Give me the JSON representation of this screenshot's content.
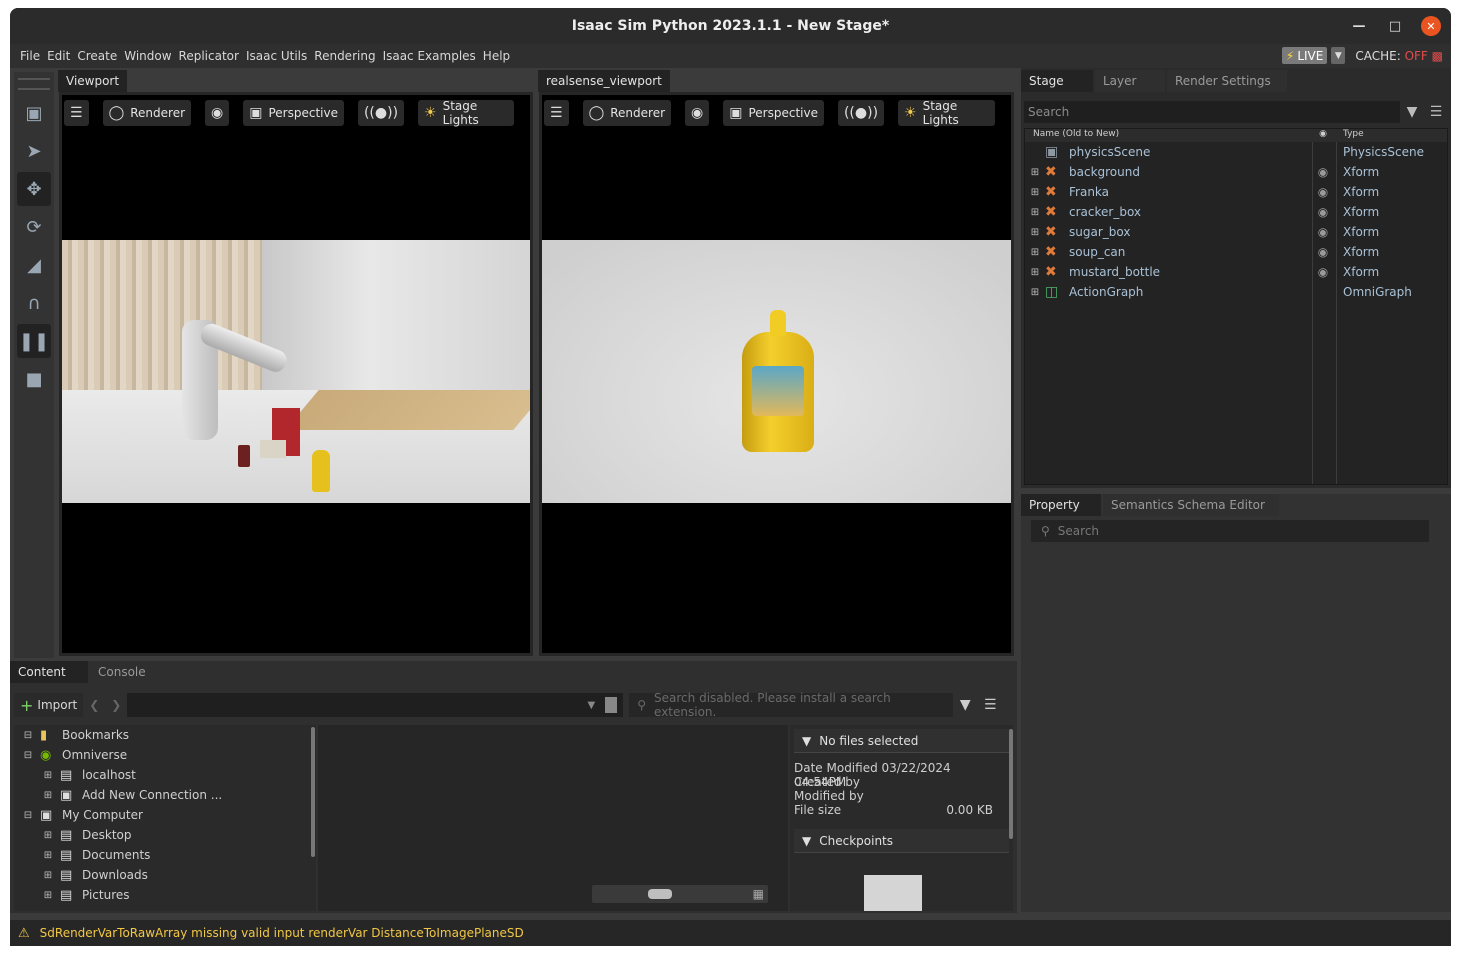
{
  "window": {
    "title": "Isaac Sim Python 2023.1.1 - New Stage*"
  },
  "menu": [
    "File",
    "Edit",
    "Create",
    "Window",
    "Replicator",
    "Isaac Utils",
    "Rendering",
    "Isaac Examples",
    "Help"
  ],
  "live": {
    "label": "LIVE",
    "cache_label": "CACHE:",
    "cache_state": "OFF"
  },
  "viewports": [
    {
      "tab": "Viewport",
      "renderer": "Renderer",
      "camera": "Perspective",
      "lights": "Stage Lights"
    },
    {
      "tab": "realsense_viewport",
      "renderer": "Renderer",
      "camera": "Perspective",
      "lights": "Stage Lights"
    }
  ],
  "stage": {
    "tabs": [
      "Stage",
      "Layer",
      "Render Settings"
    ],
    "search_placeholder": "Search",
    "col_name": "Name (Old to New)",
    "col_type": "Type",
    "rows": [
      {
        "name": "physicsScene",
        "type": "PhysicsScene",
        "icon": "cube-icon",
        "expandable": false,
        "visible": false
      },
      {
        "name": "background",
        "type": "Xform",
        "icon": "xform-icon",
        "expandable": true,
        "visible": true
      },
      {
        "name": "Franka",
        "type": "Xform",
        "icon": "xform-icon",
        "expandable": true,
        "visible": true
      },
      {
        "name": "cracker_box",
        "type": "Xform",
        "icon": "xform-icon",
        "expandable": true,
        "visible": true
      },
      {
        "name": "sugar_box",
        "type": "Xform",
        "icon": "xform-icon",
        "expandable": true,
        "visible": true
      },
      {
        "name": "soup_can",
        "type": "Xform",
        "icon": "xform-icon",
        "expandable": true,
        "visible": true
      },
      {
        "name": "mustard_bottle",
        "type": "Xform",
        "icon": "xform-icon",
        "expandable": true,
        "visible": true
      },
      {
        "name": "ActionGraph",
        "type": "OmniGraph",
        "icon": "graph-icon",
        "expandable": true,
        "visible": false
      }
    ]
  },
  "property": {
    "tabs": [
      "Property",
      "Semantics Schema Editor"
    ],
    "search_placeholder": "Search"
  },
  "content": {
    "tabs": [
      "Content",
      "Console"
    ],
    "import_label": "Import",
    "search_placeholder": "Search disabled. Please install a search extension.",
    "tree": [
      {
        "label": "Bookmarks",
        "indent": 0,
        "exp": "−",
        "icon": "bookmark-icon"
      },
      {
        "label": "Omniverse",
        "indent": 0,
        "exp": "−",
        "icon": "omniverse-icon"
      },
      {
        "label": "localhost",
        "indent": 1,
        "exp": "+",
        "icon": "drive-icon"
      },
      {
        "label": "Add New Connection ...",
        "indent": 1,
        "exp": "+",
        "icon": "add-connection-icon"
      },
      {
        "label": "My Computer",
        "indent": 0,
        "exp": "−",
        "icon": "monitor-icon"
      },
      {
        "label": "Desktop",
        "indent": 1,
        "exp": "+",
        "icon": "drive-icon"
      },
      {
        "label": "Documents",
        "indent": 1,
        "exp": "+",
        "icon": "drive-icon"
      },
      {
        "label": "Downloads",
        "indent": 1,
        "exp": "+",
        "icon": "drive-icon"
      },
      {
        "label": "Pictures",
        "indent": 1,
        "exp": "+",
        "icon": "drive-icon"
      }
    ],
    "details": {
      "header": "No files selected",
      "date_modified": "Date Modified 03/22/2024 04:54PM",
      "created_by": "Created by",
      "modified_by": "Modified by",
      "file_size_label": "File size",
      "file_size_value": "0.00 KB",
      "checkpoints": "Checkpoints"
    }
  },
  "status": {
    "message": "SdRenderVarToRawArray missing valid input renderVar DistanceToImagePlaneSD"
  },
  "colors": {
    "accent": "#7dd36b",
    "warning": "#f2c744",
    "close": "#e95420"
  }
}
